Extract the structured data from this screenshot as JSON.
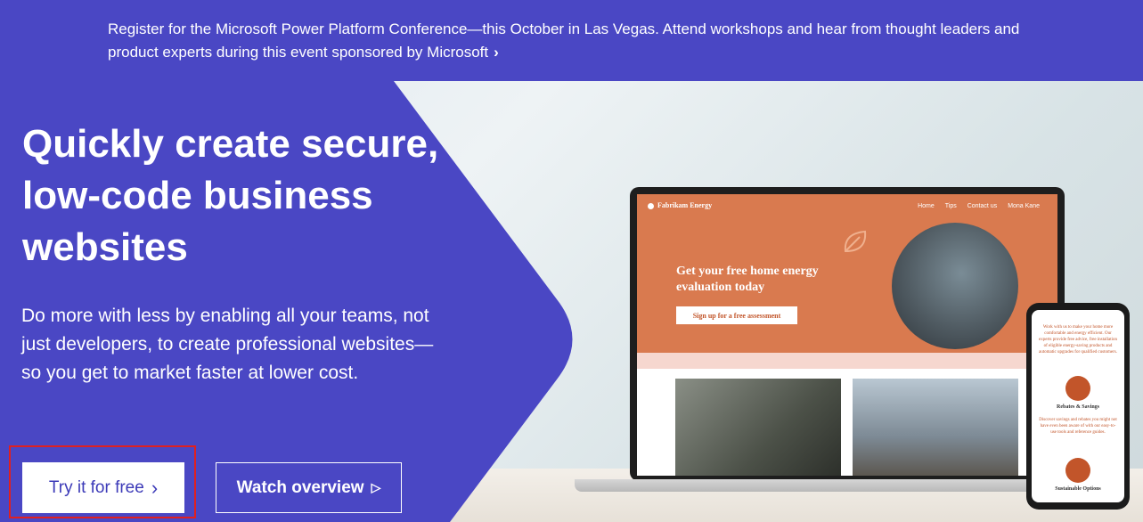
{
  "banner": {
    "text": "Register for the Microsoft Power Platform Conference—this October in Las Vegas. Attend workshops and hear from thought leaders and product experts during this event sponsored by Microsoft",
    "chevron": "›"
  },
  "hero": {
    "title": "Quickly create secure, low-code business websites",
    "subtitle": "Do more with less by enabling all your teams, not just developers, to create professional websites—so you get to market faster at lower cost.",
    "primary_button": "Try it for free",
    "primary_chevron": "›",
    "secondary_button": "Watch overview",
    "secondary_icon": "▷"
  },
  "mock_site": {
    "brand": "Fabrikam Energy",
    "nav": [
      "Home",
      "Tips",
      "Contact us",
      "Mona Kane"
    ],
    "headline": "Get your free home energy evaluation today",
    "cta": "Sign up for a free assessment"
  },
  "mock_phone": {
    "intro": "Work with us to make your home more comfortable and energy efficient. Our experts provide free advice, free installation of eligible energy-saving products and automatic upgrades for qualified customers.",
    "item1_title": "Rebates & Savings",
    "item1_text": "Discover savings and rebates you might not have even been aware of with our easy-to-use tools and reference guides.",
    "item2_title": "Sustainable Options"
  },
  "colors": {
    "brand_purple": "#4a47c4",
    "mock_orange": "#d97a4f",
    "highlight_red": "#e02020"
  }
}
